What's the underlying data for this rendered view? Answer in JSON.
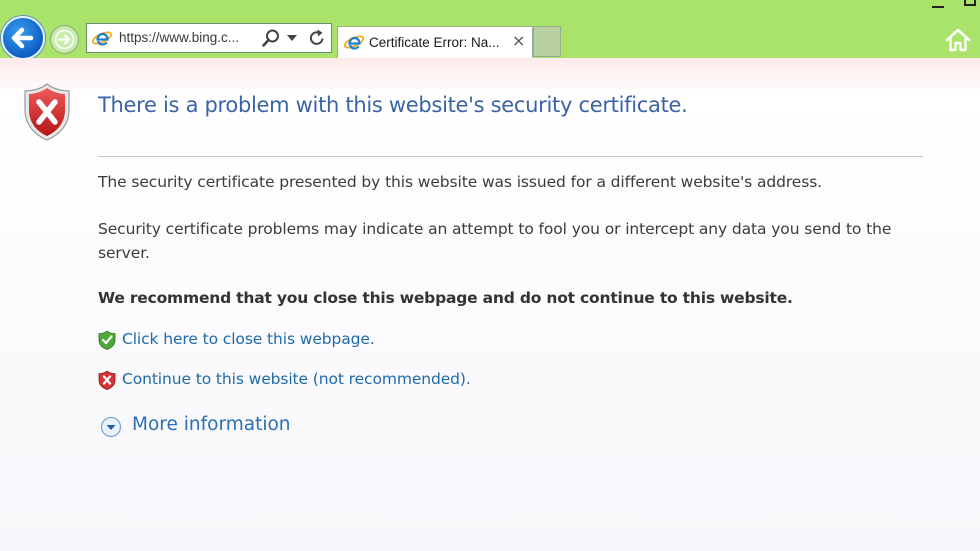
{
  "browser": {
    "url": "https://www.bing.c...",
    "tab_title": "Certificate Error: Na...",
    "tab_close": "×"
  },
  "page": {
    "heading": "There is a problem with this website's security certificate.",
    "paragraph1": "The security certificate presented by this website was issued for a different website's address.",
    "paragraph2": "Security certificate problems may indicate an attempt to fool you or intercept any data you send to the server.",
    "recommendation": "We recommend that you close this webpage and do not continue to this website.",
    "close_link": "Click here to close this webpage.",
    "continue_link": "Continue to this website (not recommended).",
    "more_info": "More information"
  },
  "icons": {
    "back": "back-arrow-icon",
    "forward": "forward-arrow-icon",
    "site": "internet-explorer-icon",
    "search": "search-icon",
    "refresh": "refresh-icon",
    "home": "home-icon",
    "error_shield": "error-shield-icon",
    "safe_shield": "green-shield-icon",
    "unsafe_shield": "red-shield-icon",
    "expand": "expand-chevron-icon"
  },
  "colors": {
    "chrome": "#a9e36a",
    "heading": "#3a63a8",
    "link": "#1e6aa8",
    "error": "#d42f2f",
    "safe": "#3f9b2e"
  }
}
